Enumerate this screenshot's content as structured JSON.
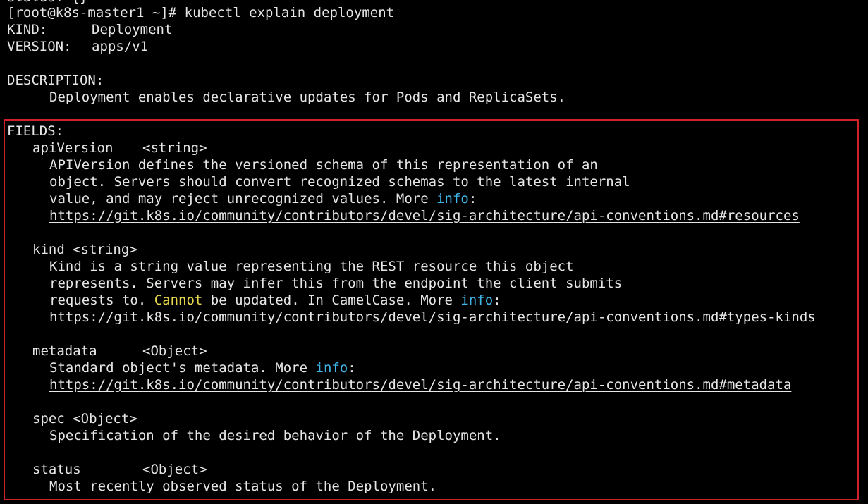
{
  "prompt": "[root@k8s-master1 ~]# kubectl explain deployment",
  "prev_line_fragment": "status: {}",
  "header": {
    "kind_label": "KIND:",
    "kind_value": "Deployment",
    "version_label": "VERSION:",
    "version_value": "apps/v1",
    "description_label": "DESCRIPTION:",
    "description_text": "Deployment enables declarative updates for Pods and ReplicaSets."
  },
  "fields_label": "FIELDS:",
  "fields": {
    "apiVersion": {
      "name": "apiVersion",
      "type": "<string>",
      "line1": "APIVersion defines the versioned schema of this representation of an",
      "line2": "object. Servers should convert recognized schemas to the latest internal",
      "line3_pre": "value, and may reject unrecognized values. More ",
      "line3_hl": "info",
      "line3_post": ":",
      "url": "https://git.k8s.io/community/contributors/devel/sig-architecture/api-conventions.md#resources"
    },
    "kind": {
      "name": "kind",
      "type": "<string>",
      "line1": "Kind is a string value representing the REST resource this object",
      "line2": "represents. Servers may infer this from the endpoint the client submits",
      "line3_pre": "requests to. ",
      "line3_yellow": "Cannot",
      "line3_mid": " be updated. In CamelCase. More ",
      "line3_hl": "info",
      "line3_post": ":",
      "url": "https://git.k8s.io/community/contributors/devel/sig-architecture/api-conventions.md#types-kinds"
    },
    "metadata": {
      "name": "metadata",
      "type": "<Object>",
      "line1_pre": "Standard object's metadata. More ",
      "line1_hl": "info",
      "line1_post": ":",
      "url": "https://git.k8s.io/community/contributors/devel/sig-architecture/api-conventions.md#metadata"
    },
    "spec": {
      "name": "spec",
      "type": "<Object>",
      "line1": "Specification of the desired behavior of the Deployment."
    },
    "status": {
      "name": "status",
      "type": "<Object>",
      "line1": "Most recently observed status of the Deployment."
    }
  },
  "colors": {
    "background": "#000000",
    "text": "#e6e6e6",
    "info_highlight": "#3fb6e8",
    "warning_highlight": "#e6d84a",
    "box_border": "#d0202a"
  }
}
